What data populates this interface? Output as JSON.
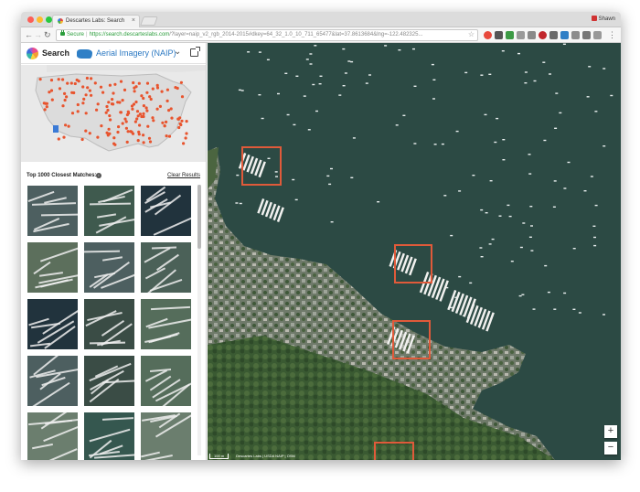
{
  "browser": {
    "tab_title": "Descartes Labs: Search",
    "tab_close": "×",
    "profile_name": "Shawn",
    "secure_label": "Secure",
    "url_host": "https://search.descarteslabs.com",
    "url_path": "/?layer=naip_v2_rgb_2014-2015#dkey=64_32_1.0_10_711_65477&lat=37.8613684&lng=-122.482325...",
    "back_glyph": "←",
    "forward_glyph": "→",
    "reload_glyph": "↻",
    "home_glyph": "⌂",
    "star_glyph": "☆",
    "extension_icons": [
      "opera-icon",
      "grid-icon",
      "notes-icon",
      "mail-icon",
      "pinterest-icon",
      "bookmark-icon",
      "code-icon",
      "puzzle-icon",
      "menu-icon"
    ]
  },
  "sidebar": {
    "search_label": "Search",
    "layer_name": "Aerial Imagery (NAIP)",
    "chevron_glyph": "⌄",
    "matches_title": "Top 1000 Closest Matches:",
    "info_glyph": "i",
    "clear_results": "Clear Results",
    "thumbnail_count": 15
  },
  "map": {
    "zoom_in": "+",
    "zoom_out": "−",
    "scale_label": "100 m",
    "attribution": "Descartes Labs | USDA NAIP | OSM"
  },
  "colors": {
    "accent": "#2b78c2",
    "highlight_box": "#e05a3a",
    "water": "#2c4a44",
    "point": "#e8542e"
  }
}
